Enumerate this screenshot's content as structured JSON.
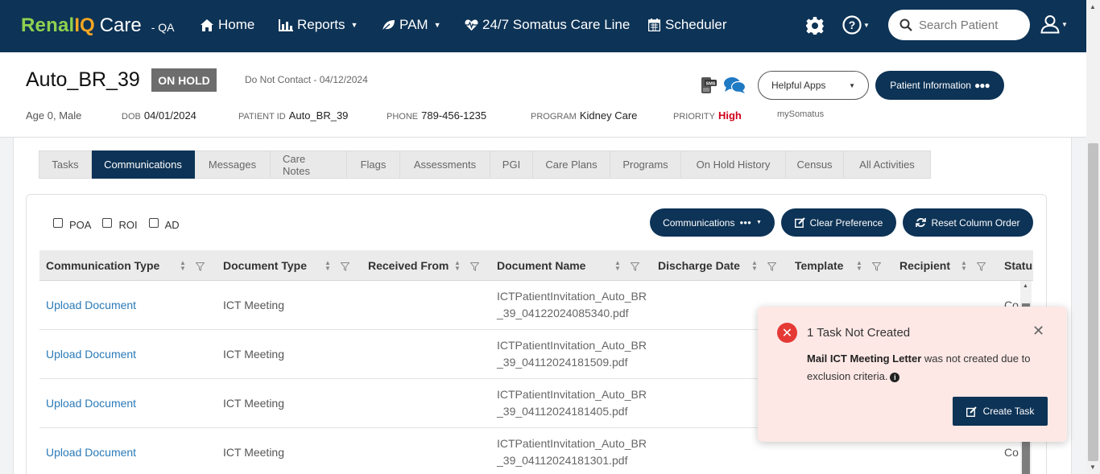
{
  "brand": {
    "renal": "Renal",
    "iq": "IQ",
    "care": "Care",
    "env": "- QA"
  },
  "nav": {
    "home": "Home",
    "reports": "Reports",
    "pam": "PAM",
    "careline": "24/7 Somatus Care Line",
    "scheduler": "Scheduler"
  },
  "search": {
    "placeholder": "Search Patient"
  },
  "patient": {
    "name": "Auto_BR_39",
    "status": "ON HOLD",
    "do_not_contact": "Do Not Contact - 04/12/2024",
    "age_gender": "Age 0, Male",
    "dob_label": "DOB",
    "dob": "04/01/2024",
    "id_label": "PATIENT ID",
    "id": "Auto_BR_39",
    "phone_label": "PHONE",
    "phone": "789-456-1235",
    "program_label": "PROGRAM",
    "program": "Kidney Care",
    "priority_label": "PRIORITY",
    "priority": "High",
    "my_somatus": "mySomatus"
  },
  "header_buttons": {
    "helpful_apps": "Helpful Apps",
    "patient_information": "Patient Information"
  },
  "tabs": [
    {
      "label": "Tasks",
      "active": false
    },
    {
      "label": "Communications",
      "active": true
    },
    {
      "label": "Messages",
      "active": false
    },
    {
      "label": "Care Notes",
      "active": false
    },
    {
      "label": "Flags",
      "active": false
    },
    {
      "label": "Assessments",
      "active": false
    },
    {
      "label": "PGI",
      "active": false
    },
    {
      "label": "Care Plans",
      "active": false
    },
    {
      "label": "Programs",
      "active": false
    },
    {
      "label": "On Hold History",
      "active": false
    },
    {
      "label": "Census",
      "active": false
    },
    {
      "label": "All Activities",
      "active": false
    }
  ],
  "filters": {
    "poa": "POA",
    "roi": "ROI",
    "ad": "AD"
  },
  "toolbar": {
    "communications": "Communications",
    "clear_preference": "Clear Preference",
    "reset_column_order": "Reset Column Order"
  },
  "table": {
    "columns": [
      "Communication Type",
      "Document Type",
      "Received From",
      "Document Name",
      "Discharge Date",
      "Template",
      "Recipient",
      "Status"
    ],
    "rows": [
      {
        "communication_type": "Upload Document",
        "document_type": "ICT Meeting",
        "received_from": "",
        "document_name": "ICTPatientInvitation_Auto_BR_39_04122024085340.pdf",
        "status": "Co"
      },
      {
        "communication_type": "Upload Document",
        "document_type": "ICT Meeting",
        "received_from": "",
        "document_name": "ICTPatientInvitation_Auto_BR_39_04112024181509.pdf",
        "status": ""
      },
      {
        "communication_type": "Upload Document",
        "document_type": "ICT Meeting",
        "received_from": "",
        "document_name": "ICTPatientInvitation_Auto_BR_39_04112024181405.pdf",
        "status": ""
      },
      {
        "communication_type": "Upload Document",
        "document_type": "ICT Meeting",
        "received_from": "",
        "document_name": "ICTPatientInvitation_Auto_BR_39_04112024181301.pdf",
        "status": "Co"
      }
    ]
  },
  "toast": {
    "title": "1 Task Not Created",
    "task_name": "Mail ICT Meeting Letter",
    "message": " was not created due to exclusion criteria.",
    "button": "Create Task"
  },
  "colors": {
    "navy": "#0d3356",
    "error": "#e53935",
    "priority_high": "#d0021b",
    "link": "#2a7ab8"
  }
}
